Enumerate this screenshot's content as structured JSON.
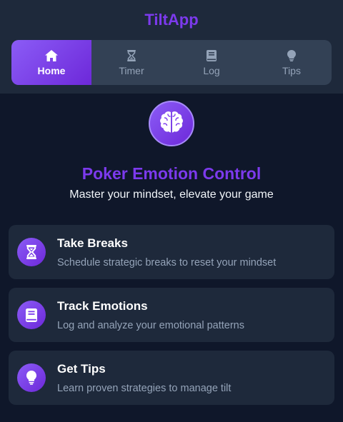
{
  "app": {
    "title": "TiltApp"
  },
  "nav": {
    "tabs": [
      {
        "label": "Home",
        "icon": "home-icon",
        "active": true
      },
      {
        "label": "Timer",
        "icon": "hourglass-icon",
        "active": false
      },
      {
        "label": "Log",
        "icon": "book-icon",
        "active": false
      },
      {
        "label": "Tips",
        "icon": "lightbulb-icon",
        "active": false
      }
    ]
  },
  "hero": {
    "icon": "brain-icon",
    "title": "Poker Emotion Control",
    "subtitle": "Master your mindset, elevate your game"
  },
  "features": [
    {
      "icon": "hourglass-icon",
      "title": "Take Breaks",
      "description": "Schedule strategic breaks to reset your mindset"
    },
    {
      "icon": "book-icon",
      "title": "Track Emotions",
      "description": "Log and analyze your emotional patterns"
    },
    {
      "icon": "lightbulb-icon",
      "title": "Get Tips",
      "description": "Learn proven strategies to manage tilt"
    }
  ],
  "colors": {
    "accent": "#7c3aed",
    "background": "#0f172a",
    "surface": "#1e293b",
    "nav_background": "#334155",
    "muted_text": "#94a3b8"
  }
}
